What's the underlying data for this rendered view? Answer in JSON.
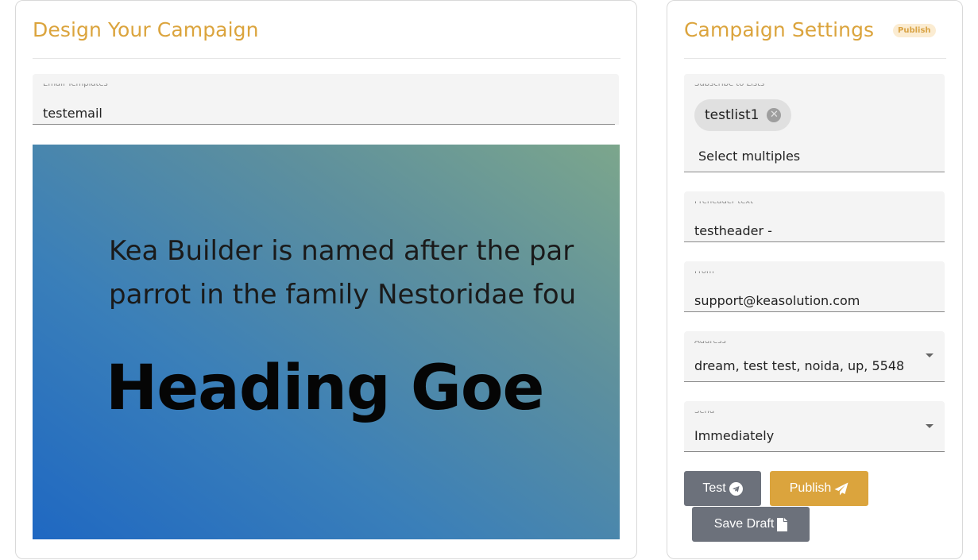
{
  "design": {
    "title": "Design Your Campaign",
    "template_field": {
      "label": "Email Templates",
      "value": "testemail"
    },
    "preview": {
      "line1": "Kea Builder is named after the par",
      "line2": "parrot in the family Nestoridae fou",
      "heading": "Heading Goe"
    }
  },
  "settings": {
    "title": "Campaign Settings",
    "badge": "Publish",
    "lists_field": {
      "label": "Subscribe to Lists",
      "chip": "testlist1",
      "placeholder": "Select multiples"
    },
    "preheader_field": {
      "label": "Preheader text",
      "value": "testheader -"
    },
    "from_field": {
      "label": "From",
      "value": "support@keasolution.com"
    },
    "address_field": {
      "label": "Address",
      "value": "dream, test test, noida, up, 5548"
    },
    "send_field": {
      "label": "Send",
      "value": "Immediately"
    },
    "buttons": {
      "test": "Test",
      "publish": "Publish",
      "save_draft": "Save Draft"
    }
  },
  "colors": {
    "accent": "#dba43d",
    "button_gray": "#6c717b",
    "badge_bg": "#fbecd2"
  },
  "icons": {
    "test": "telegram-icon",
    "publish": "paper-plane-icon",
    "save_draft": "file-icon",
    "chip_delete": "cancel-icon",
    "select": "caret-down-icon"
  }
}
